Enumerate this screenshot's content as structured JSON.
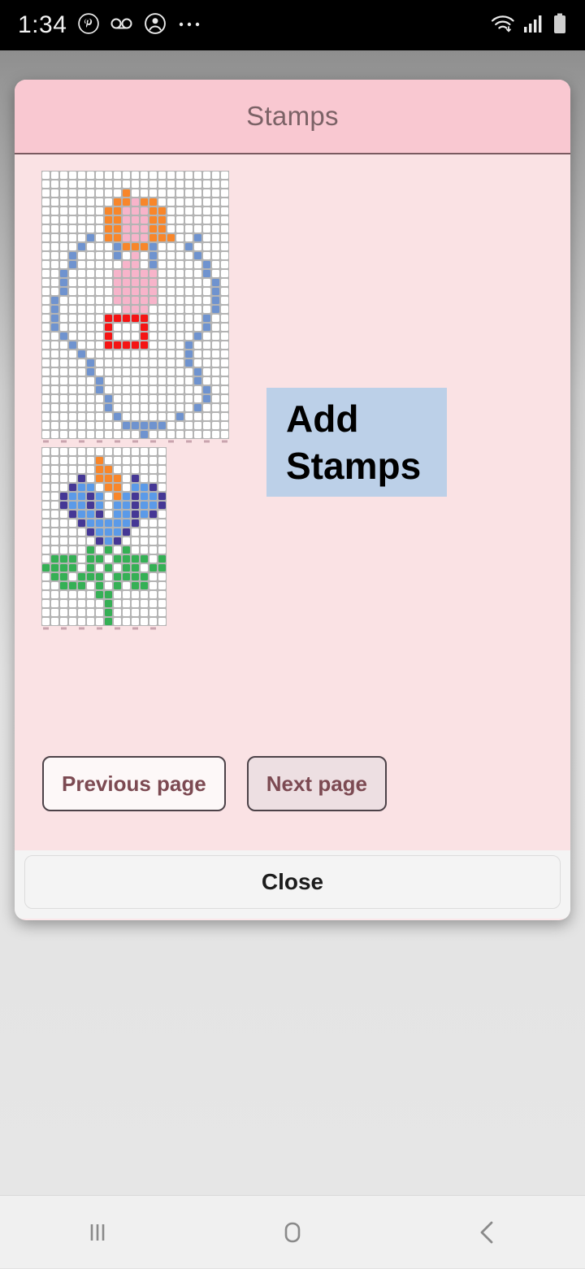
{
  "statusbar": {
    "time": "1:34",
    "left_icons": [
      "pinterest-icon",
      "voicemail-icon",
      "account-icon",
      "more-notifications-icon"
    ],
    "right_icons": [
      "wifi-icon",
      "cellular-signal-icon",
      "battery-icon"
    ]
  },
  "dialog": {
    "title": "Stamps",
    "title_bg": "#f9c8d1",
    "body_bg": "#fae2e4",
    "add_stamps_label_line1": "Add",
    "add_stamps_label_line2": "Stamps",
    "add_stamps_bg": "#bcd0e8",
    "previous_page_label": "Previous page",
    "next_page_label": "Next page",
    "close_label": "Close"
  },
  "navbar": {
    "recents_label": "recents-icon",
    "home_label": "home-icon",
    "back_label": "back-icon"
  },
  "palette": {
    "empty": "#ffffff",
    "grid_line": "#b4b4b4",
    "orange": "#f8862a",
    "pink": "#f7b4ca",
    "blue": "#6f93cf",
    "red": "#f51414",
    "purple": "#453795",
    "lightblue": "#5b9ae8",
    "green": "#35b055"
  },
  "stamps": [
    {
      "name": "angel-stamp",
      "cols": 21,
      "rows": 30,
      "cell": 11,
      "legend": {
        "0": "empty",
        "O": "orange",
        "P": "pink",
        "B": "blue",
        "R": "red"
      },
      "rows_data": [
        "0000000000000000000000",
        "000000000000000000000",
        "000000000O00000000000",
        "00000000OOPOO00000000",
        "0000000OOPPPOO0000000",
        "0000000OOPPPOO0000000",
        "0000000OOPPPOO0000000",
        "00000B0OOPPPOOO00B000",
        "0000B000BOOOB000B0000",
        "000B0000B0P0B0000B000",
        "000B00000PP0B00000B00",
        "00B00000PPPPP00000B00",
        "00B00000PPPPP000000B0",
        "00B00000PPPPP000000B0",
        "0B000000PPPPP000000B0",
        "0B0000000PPP0000000B0",
        "0B00000RRRRR000000B00",
        "0B00000R000R000000B00",
        "00B0000R000R00000B000",
        "000B000RRRRR0000B0000",
        "0000B00000000000B0000",
        "00000B0000000000B0000",
        "00000B00000000000B000",
        "000000B0000000000B000",
        "000000B00000000000B00",
        "0000000B0000000000B00",
        "0000000B000000000B000",
        "00000000B000000B00000",
        "000000000BBBBB0000000",
        "00000000000B000000000"
      ]
    },
    {
      "name": "flower-stamp",
      "cols": 14,
      "rows": 20,
      "cell": 11,
      "legend": {
        "0": "empty",
        "O": "orange",
        "V": "purple",
        "L": "lightblue",
        "G": "green"
      },
      "rows_data": [
        "00000000000000",
        "000000O0000000",
        "000000OO000000",
        "0000V0OOO0V000",
        "000VLL0OO0LLV0",
        "00VLLVL0OLVLLV",
        "00VLLVL0LLVLLV",
        "000VLLV0LLVLV0",
        "0000VLLLLLV000",
        "00000VLLLV0000",
        "000000VLV00000",
        "00000G0G0G0000",
        "0GGG0GG0GGGG0G",
        "GGGG0G0G0GG0GG",
        "0GG0GGG0GGGG00",
        "00GGG0G0G0GG00",
        "000000GG000000",
        "0000000G000000",
        "0000000G000000",
        "0000000G000000"
      ]
    }
  ]
}
